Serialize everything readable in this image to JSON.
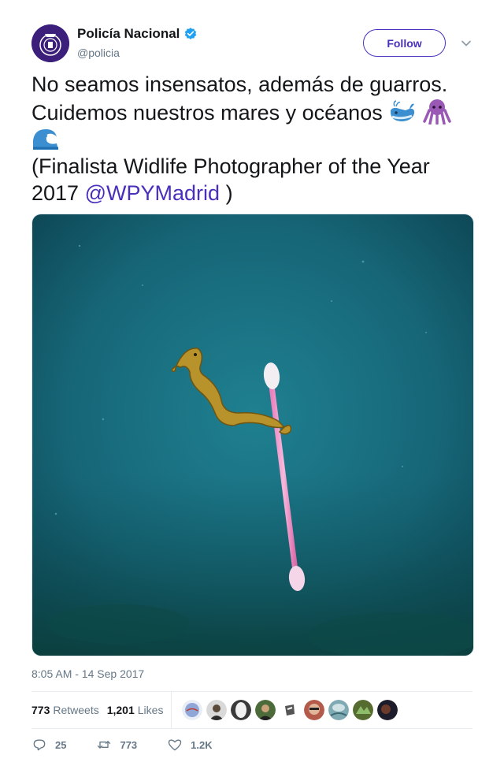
{
  "account": {
    "name": "Policía Nacional",
    "handle": "@policia",
    "follow_label": "Follow"
  },
  "tweet": {
    "line1": "No seamos insensatos, además de guarros.",
    "line2": "Cuidemos nuestros mares y océanos",
    "line4": "(Finalista Widlife Photographer of the Year",
    "line5_prefix": "2017",
    "mention": "@WPYMadrid",
    "line5_suffix": ")",
    "emojis": [
      "whale-icon",
      "octopus-icon",
      "wave-icon"
    ]
  },
  "timestamp": "8:05 AM - 14 Sep 2017",
  "stats": {
    "retweets_count": "773",
    "retweets_label": "Retweets",
    "likes_count": "1,201",
    "likes_label": "Likes"
  },
  "actions": {
    "reply_count": "25",
    "retweet_count": "773",
    "like_count": "1.2K"
  },
  "colors": {
    "accent": "#4a2fbd",
    "text": "#14171a",
    "muted": "#657786",
    "verified": "#1da1f2",
    "photo_water": "#1a6a7a"
  }
}
